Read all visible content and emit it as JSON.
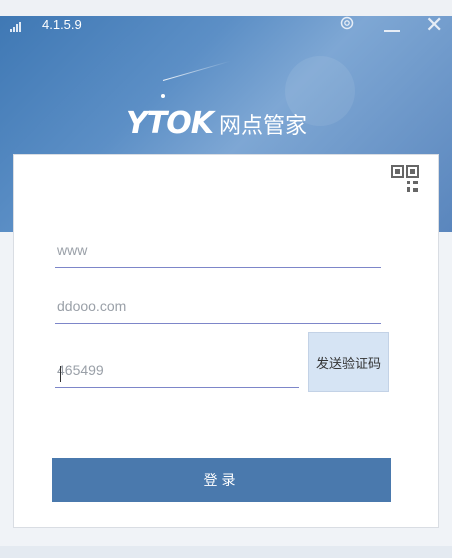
{
  "window": {
    "version": "4.1.5.9",
    "icons": [
      "signal-icon",
      "settings-icon",
      "minimize-icon",
      "close-icon"
    ],
    "close_glyph": "✕"
  },
  "brand": {
    "mark": "YTOK",
    "name": "网点管家"
  },
  "form": {
    "field1": {
      "value": "www"
    },
    "field2": {
      "value": "ddooo.com"
    },
    "code": {
      "value": "465499"
    },
    "send_code_label": "发送验证码",
    "login_label": "登录"
  },
  "colors": {
    "header": "#4a7fb8",
    "accent": "#4a79ad",
    "underline": "#7d86c9",
    "send_button": "#d6e4f4"
  }
}
